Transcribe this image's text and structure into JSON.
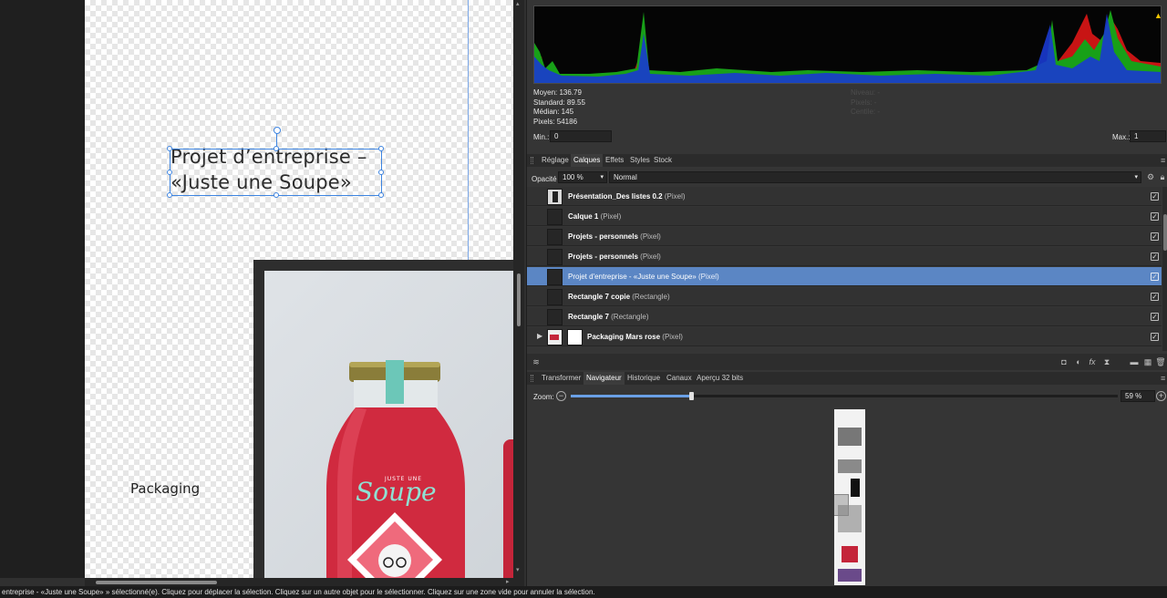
{
  "colors": {
    "selection_blue": "#3d84e0",
    "layer_selected_bg": "#5b86c4",
    "panel_bg": "#353535",
    "histogram_warning": "#f2c500"
  },
  "canvas": {
    "title_line1": "Projet d’entreprise –",
    "title_line2": "«Juste une Soupe»",
    "packaging_label": "Packaging",
    "bottle_brand_small": "JUSTE UNE",
    "bottle_brand_script": "Soupe"
  },
  "histogram": {
    "warning_icon": "warning-triangle-icon",
    "stats": [
      "Moyen: 136.79",
      "Standard: 89.55",
      "Médian: 145",
      "Pixels: 54186"
    ],
    "stats_disabled": [
      "Niveau: -",
      "Pixels: -",
      "Centile: -"
    ],
    "min_label": "Min.:",
    "min_value": "0",
    "max_label": "Max.:",
    "max_value": "1"
  },
  "layers_panel": {
    "tabs": [
      "Réglage",
      "Calques",
      "Effets",
      "Styles",
      "Stock"
    ],
    "active_tab": "Calques",
    "opacity_label": "Opacité",
    "opacity_value": "100 %",
    "blend_mode": "Normal",
    "layers": [
      {
        "name": "Présentation_Des listes 0.2",
        "type": "(Pixel)",
        "checked": true,
        "selected": false
      },
      {
        "name": "Calque 1",
        "type": "(Pixel)",
        "checked": true,
        "selected": false
      },
      {
        "name": "Projets - personnels",
        "type": "(Pixel)",
        "checked": true,
        "selected": false
      },
      {
        "name": "Projets - personnels",
        "type": "(Pixel)",
        "checked": true,
        "selected": false
      },
      {
        "name": "Projet d'entreprise - «Juste une Soupe»",
        "type": "(Pixel)",
        "checked": true,
        "selected": true
      },
      {
        "name": "Rectangle 7 copie",
        "type": "(Rectangle)",
        "checked": true,
        "selected": false
      },
      {
        "name": "Rectangle 7",
        "type": "(Rectangle)",
        "checked": true,
        "selected": false
      },
      {
        "name": "Packaging Mars rose",
        "type": "(Pixel)",
        "checked": true,
        "selected": false
      }
    ],
    "bottom_icons": [
      "layers-stack-icon",
      "mask-icon",
      "adjustment-icon",
      "fx-icon",
      "hourglass-icon",
      "group-folder-icon",
      "pixel-layer-icon",
      "trash-icon"
    ]
  },
  "navigator_panel": {
    "tabs": [
      "Transformer",
      "Navigateur",
      "Historique",
      "Canaux",
      "Aperçu 32 bits"
    ],
    "active_tab": "Navigateur",
    "zoom_label": "Zoom:",
    "zoom_value": "59 %",
    "zoom_fraction": 0.22
  },
  "statusbar": {
    "text": "entreprise - «Juste une Soupe» » sélectionné(e). Cliquez pour déplacer la sélection. Cliquez sur un autre objet pour le sélectionner. Cliquez sur une zone vide pour annuler la sélection."
  }
}
